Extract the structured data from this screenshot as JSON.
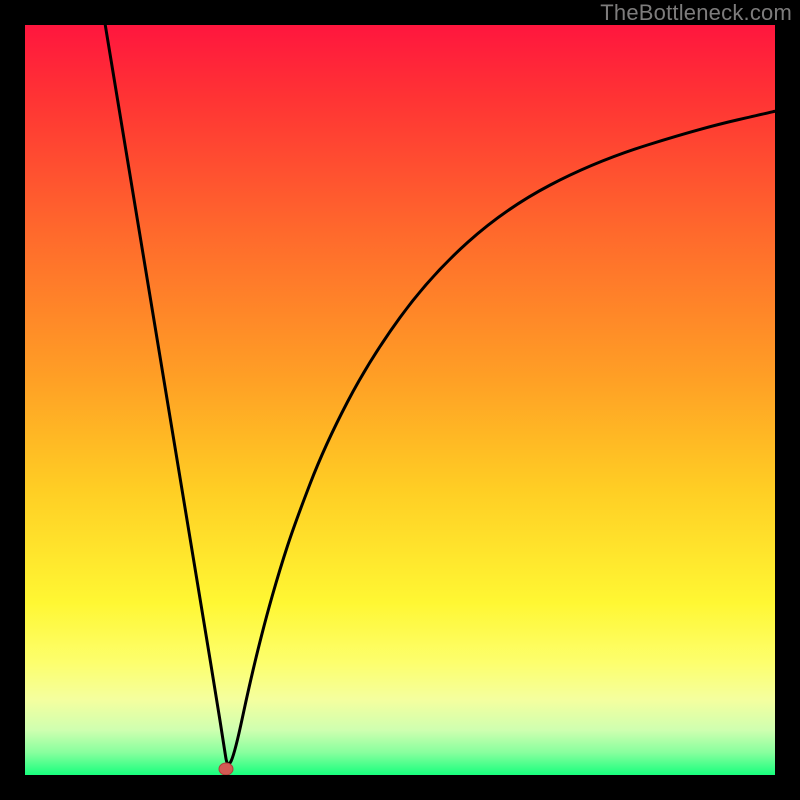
{
  "attribution": "TheBottleneck.com",
  "colors": {
    "page_bg": "#000000",
    "attribution_text": "#7d7c7c",
    "gradient_stops": [
      {
        "offset": 0.0,
        "color": "#ff163e"
      },
      {
        "offset": 0.1,
        "color": "#ff3434"
      },
      {
        "offset": 0.28,
        "color": "#ff6a2c"
      },
      {
        "offset": 0.47,
        "color": "#ff9f25"
      },
      {
        "offset": 0.62,
        "color": "#ffce24"
      },
      {
        "offset": 0.77,
        "color": "#fff733"
      },
      {
        "offset": 0.85,
        "color": "#fdff6d"
      },
      {
        "offset": 0.9,
        "color": "#f4ff9f"
      },
      {
        "offset": 0.94,
        "color": "#cfffb0"
      },
      {
        "offset": 0.97,
        "color": "#88ff9e"
      },
      {
        "offset": 1.0,
        "color": "#18ff7d"
      }
    ],
    "curve_stroke": "#000000",
    "marker_fill": "#d25a54",
    "marker_stroke": "#b03f3a"
  },
  "chart_data": {
    "type": "line",
    "title": "",
    "xlabel": "",
    "ylabel": "",
    "xlim": [
      0,
      100
    ],
    "ylim": [
      0,
      100
    ],
    "grid": false,
    "series": [
      {
        "name": "bottleneck-curve",
        "x": [
          10.7,
          12,
          14,
          16,
          18,
          20,
          22,
          24,
          25.5,
          26.5,
          27,
          28,
          30,
          32,
          34,
          36,
          40,
          46,
          54,
          64,
          76,
          90,
          100
        ],
        "values": [
          100,
          92.1,
          80,
          67.9,
          55.8,
          43.7,
          31.6,
          19.5,
          10.4,
          4.1,
          0.8,
          3,
          12.4,
          20.5,
          27.5,
          33.6,
          44,
          55.5,
          66.5,
          75.5,
          81.8,
          86.2,
          88.5
        ]
      }
    ],
    "marker": {
      "x": 26.8,
      "y": 0.8
    }
  }
}
